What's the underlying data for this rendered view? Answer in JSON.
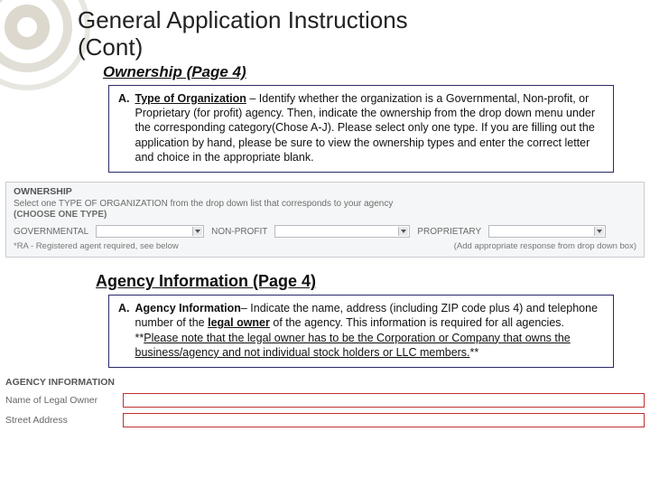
{
  "title_line1": "General Application Instructions",
  "title_line2": "(Cont)",
  "ownership": {
    "heading": "Ownership (Page 4)",
    "item_label": "A.",
    "item_lead": "Type of Organization",
    "item_text": " – Identify whether the organization is a Governmental, Non-profit,  or Proprietary (for profit) agency.  Then, indicate the ownership from the drop down menu under the corresponding category(Chose A-J).  Please select only one type. If you are filling out the application by hand, please be sure to view the ownership types and enter the correct letter and choice in the appropriate blank.",
    "form": {
      "header": "OWNERSHIP",
      "sub": "Select one TYPE OF ORGANIZATION from the drop down list that corresponds to your agency",
      "choose": "(CHOOSE ONE TYPE)",
      "gov": "GOVERNMENTAL",
      "np": "NON-PROFIT",
      "prop": "PROPRIETARY",
      "ra": "*RA - Registered agent required, see below",
      "hint": "(Add appropriate response from drop down box)"
    }
  },
  "agency": {
    "heading": "Agency Information (Page 4)",
    "item_label": "A.",
    "item_lead": "Agency Information",
    "item_text_1": "– Indicate the name, address (including ZIP code plus 4) and telephone number of the ",
    "item_text_owner": "legal owner",
    "item_text_2": " of the agency.  This information is required for all agencies.  **",
    "item_text_note": "Please note that the legal owner has to be the Corporation or Company that owns the business/agency and not individual stock holders or LLC members.",
    "item_text_3": "**",
    "form": {
      "header": "AGENCY INFORMATION",
      "name_label": "Name of Legal Owner",
      "addr_label": "Street Address"
    }
  }
}
